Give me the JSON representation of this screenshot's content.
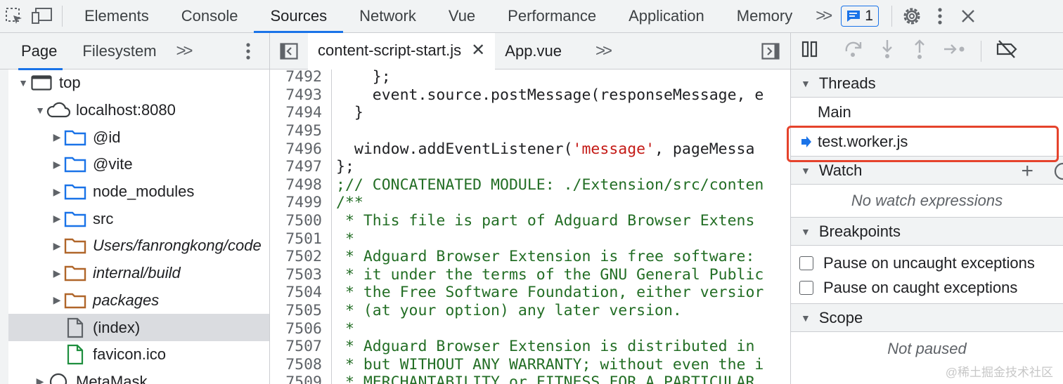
{
  "toolbar": {
    "tabs": [
      "Elements",
      "Console",
      "Sources",
      "Network",
      "Vue",
      "Performance",
      "Application",
      "Memory"
    ],
    "active_tab": "Sources",
    "issues_count": "1"
  },
  "navigator": {
    "tabs": [
      "Page",
      "Filesystem"
    ],
    "tree": [
      {
        "label": "top",
        "italic": false
      },
      {
        "label": "localhost:8080",
        "italic": false
      },
      {
        "label": "@id",
        "italic": false
      },
      {
        "label": "@vite",
        "italic": false
      },
      {
        "label": "node_modules",
        "italic": false
      },
      {
        "label": "src",
        "italic": false
      },
      {
        "label": "Users/fanrongkong/code",
        "italic": true
      },
      {
        "label": "internal/build",
        "italic": true
      },
      {
        "label": "packages",
        "italic": true
      },
      {
        "label": "(index)",
        "italic": false
      },
      {
        "label": "favicon.ico",
        "italic": false
      },
      {
        "label": "MetaMask",
        "italic": false
      }
    ]
  },
  "editor": {
    "tabs": [
      "content-script-start.js",
      "App.vue"
    ],
    "lines": [
      {
        "n": "7492",
        "text": "    };"
      },
      {
        "n": "7493",
        "text": "    event.source.postMessage(responseMessage, e"
      },
      {
        "n": "7494",
        "text": "  }"
      },
      {
        "n": "7495",
        "text": ""
      },
      {
        "n": "7496",
        "text": "  window.addEventListener('message', pageMessa"
      },
      {
        "n": "7497",
        "text": "};"
      },
      {
        "n": "7498",
        "text": ";// CONCATENATED MODULE: ./Extension/src/conten"
      },
      {
        "n": "7499",
        "text": "/**"
      },
      {
        "n": "7500",
        "text": " * This file is part of Adguard Browser Extens"
      },
      {
        "n": "7501",
        "text": " *"
      },
      {
        "n": "7502",
        "text": " * Adguard Browser Extension is free software:"
      },
      {
        "n": "7503",
        "text": " * it under the terms of the GNU General Public"
      },
      {
        "n": "7504",
        "text": " * the Free Software Foundation, either versior"
      },
      {
        "n": "7505",
        "text": " * (at your option) any later version."
      },
      {
        "n": "7506",
        "text": " *"
      },
      {
        "n": "7507",
        "text": " * Adguard Browser Extension is distributed in"
      },
      {
        "n": "7508",
        "text": " * but WITHOUT ANY WARRANTY; without even the i"
      },
      {
        "n": "7509",
        "text": " * MERCHANTABILITY or FITNESS FOR A PARTICULAR"
      }
    ]
  },
  "debugger": {
    "threads_title": "Threads",
    "threads": [
      "Main",
      "test.worker.js"
    ],
    "watch_title": "Watch",
    "watch_empty": "No watch expressions",
    "breakpoints_title": "Breakpoints",
    "breakpoint_options": [
      "Pause on uncaught exceptions",
      "Pause on caught exceptions"
    ],
    "scope_title": "Scope",
    "scope_empty": "Not paused"
  },
  "watermark": "@稀土掘金技术社区"
}
